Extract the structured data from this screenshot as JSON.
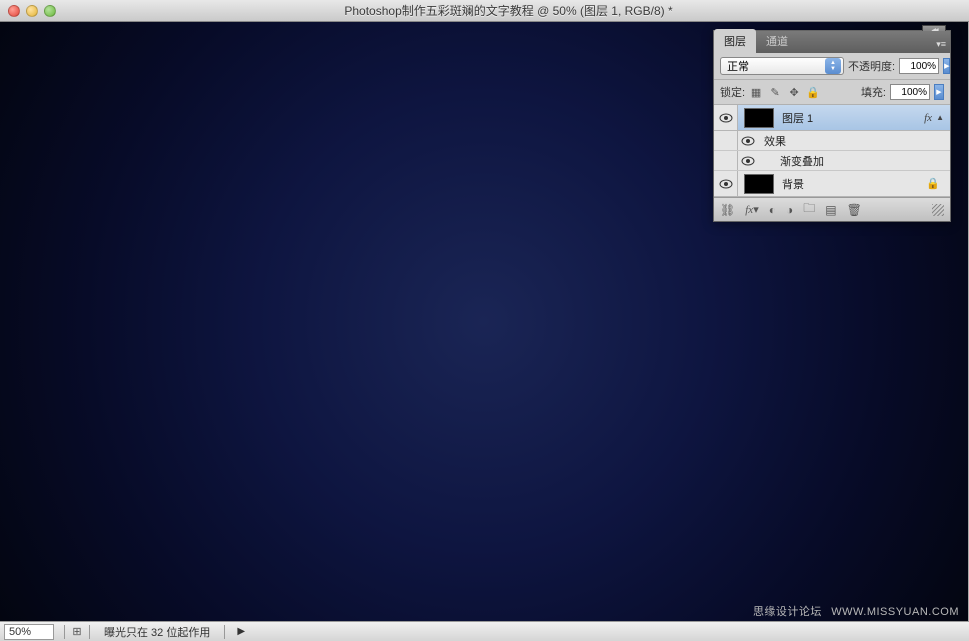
{
  "titlebar": {
    "title": "Photoshop制作五彩斑斓的文字教程 @ 50% (图层 1, RGB/8) *"
  },
  "statusbar": {
    "zoom": "50%",
    "info": "曝光只在 32 位起作用",
    "arrow": "▶"
  },
  "panel": {
    "tabs": {
      "layers": "图层",
      "channels": "通道"
    },
    "blend_mode": "正常",
    "opacity_label": "不透明度:",
    "opacity_value": "100%",
    "lock_label": "锁定:",
    "fill_label": "填充:",
    "fill_value": "100%",
    "fx_label": "fx",
    "effects_label": "效果",
    "gradient_overlay_label": "渐变叠加"
  },
  "layers": [
    {
      "name": "图层 1",
      "has_fx": true
    },
    {
      "name": "背景",
      "locked": true
    }
  ],
  "watermark": {
    "left": "思缘设计论坛",
    "right": "WWW.MISSYUAN.COM"
  }
}
